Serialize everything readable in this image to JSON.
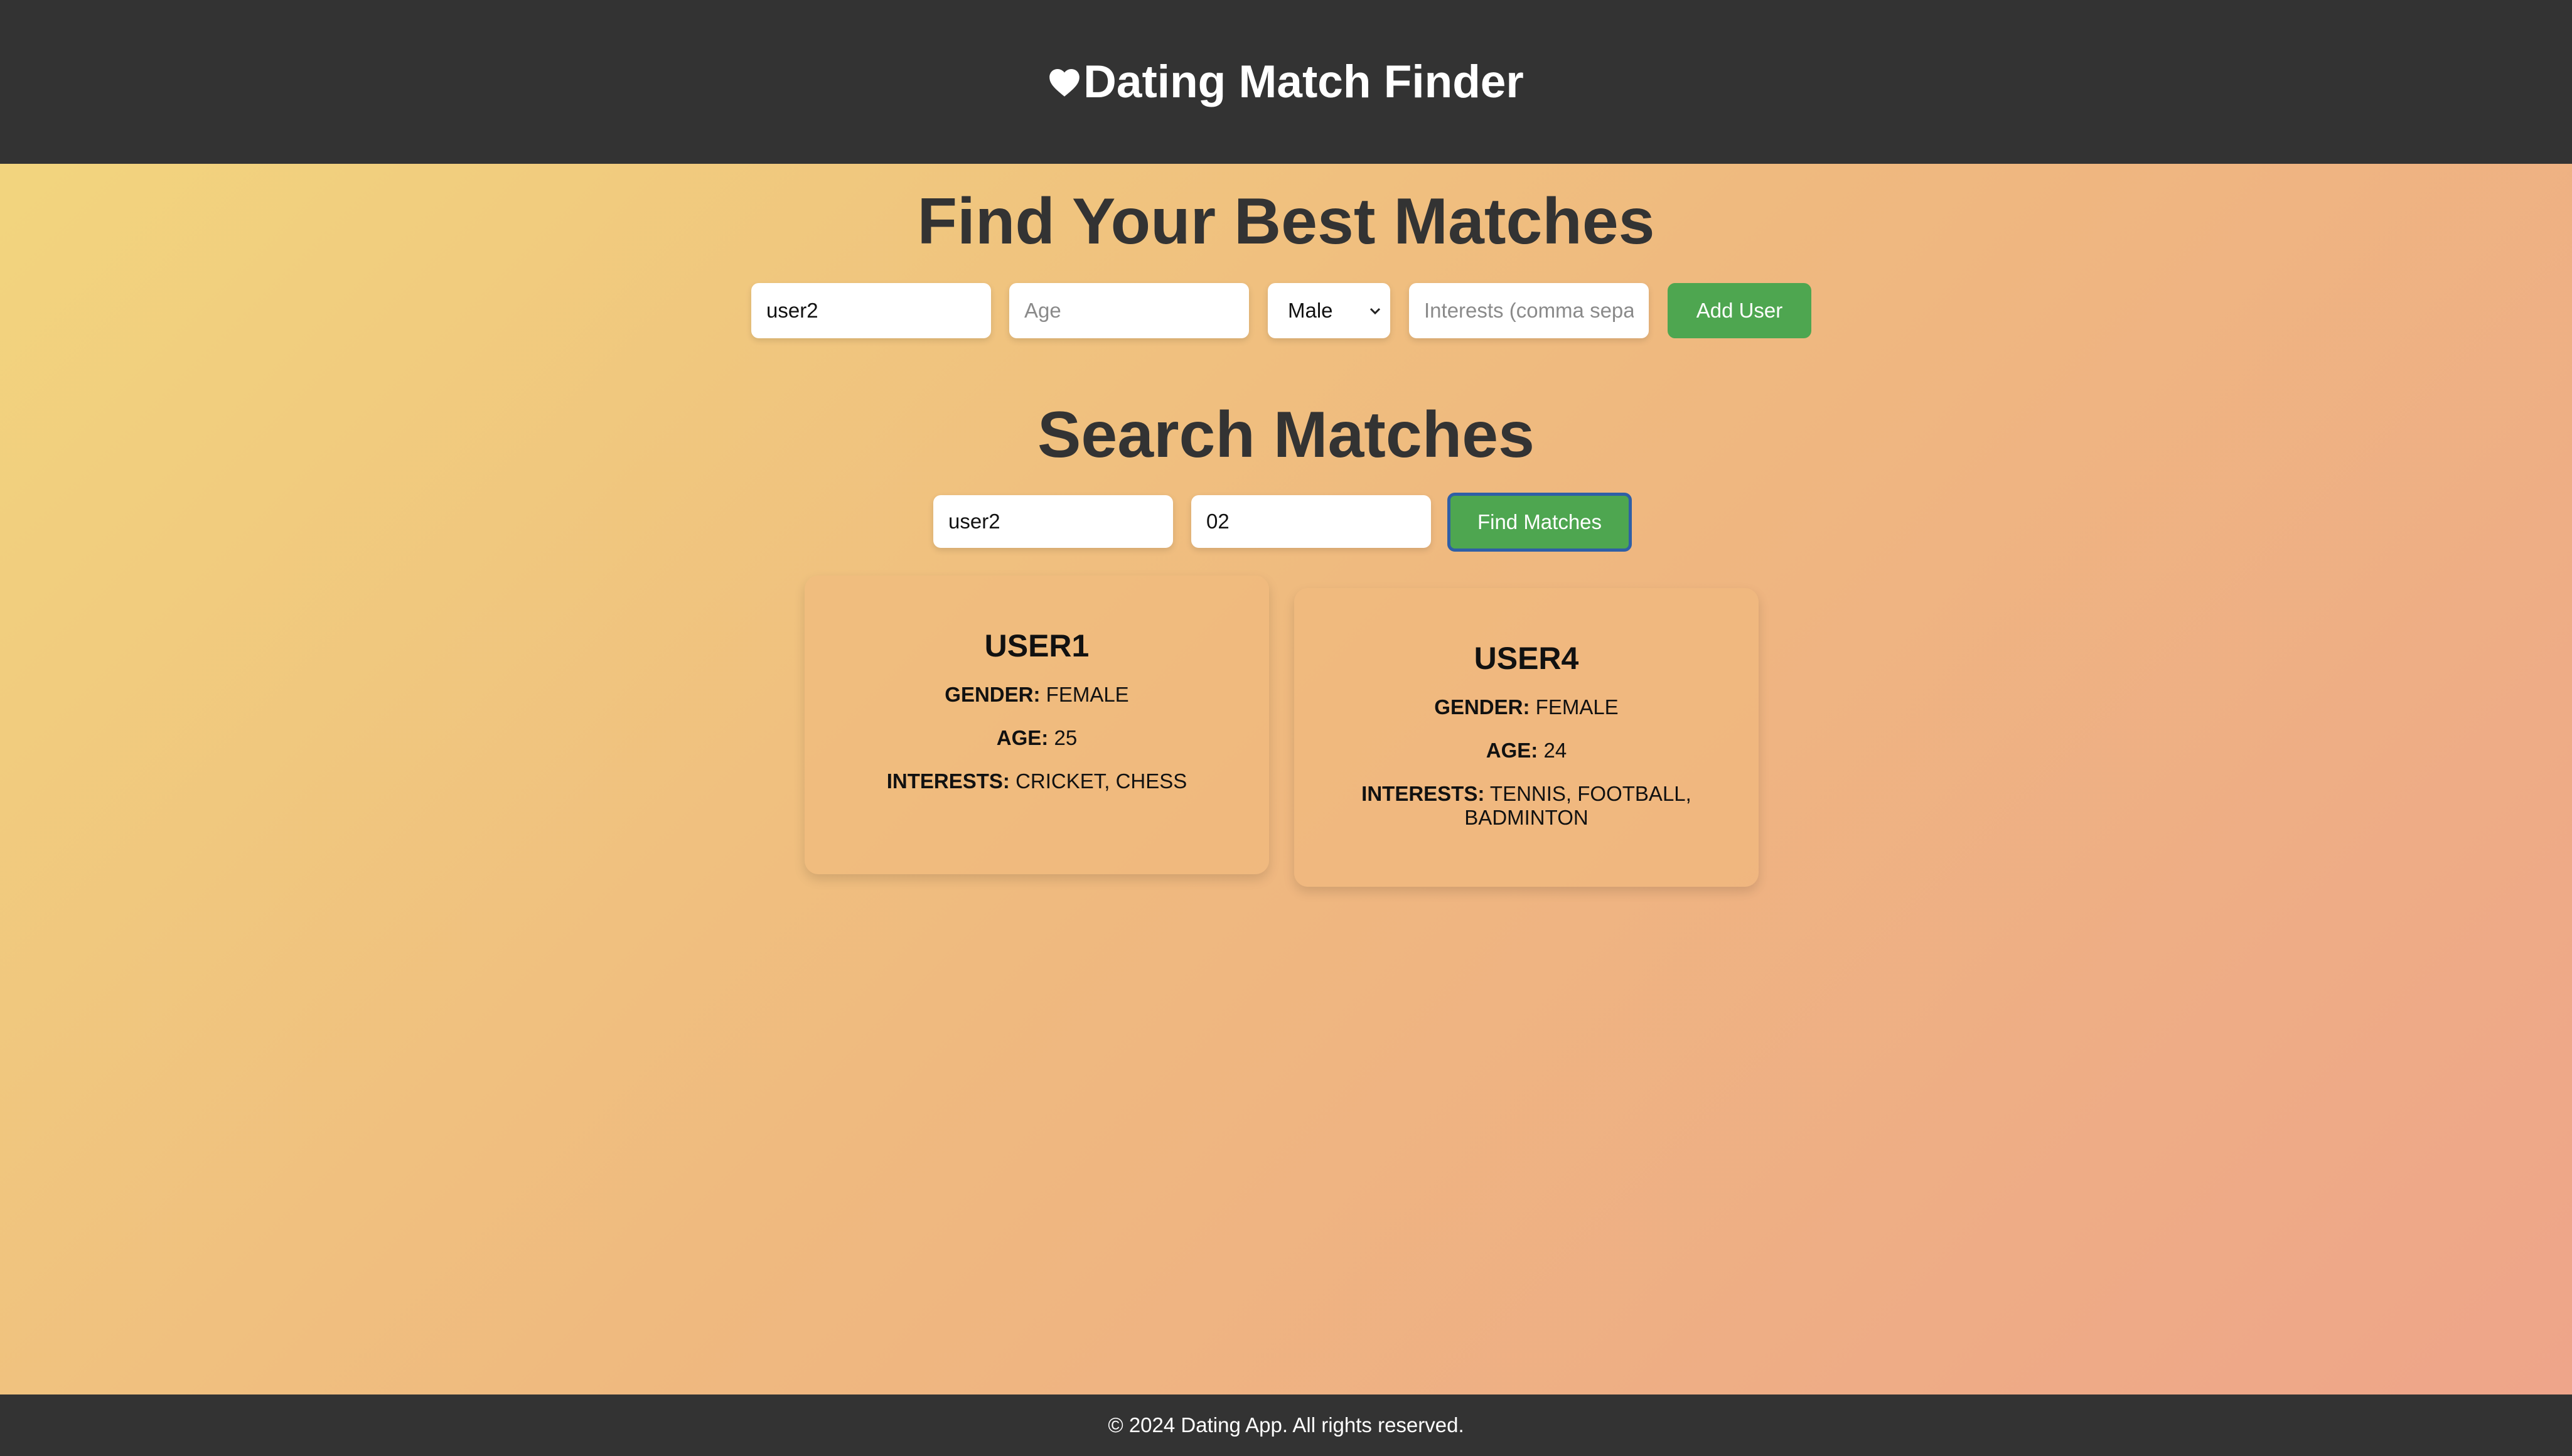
{
  "header": {
    "title": "Dating Match Finder",
    "icon": "heart-icon"
  },
  "add_user": {
    "heading": "Find Your Best Matches",
    "username_value": "user2",
    "age_placeholder": "Age",
    "gender_selected": "Male",
    "interests_placeholder": "Interests (comma separated)",
    "submit_label": "Add User"
  },
  "search": {
    "heading": "Search Matches",
    "username_value": "user2",
    "count_value": "02",
    "submit_label": "Find Matches"
  },
  "matches": [
    {
      "name": "USER1",
      "gender_label": "GENDER:",
      "gender": "FEMALE",
      "age_label": "AGE:",
      "age": "25",
      "interests_label": "INTERESTS:",
      "interests": "CRICKET, CHESS"
    },
    {
      "name": "USER4",
      "gender_label": "GENDER:",
      "gender": "FEMALE",
      "age_label": "AGE:",
      "age": "24",
      "interests_label": "INTERESTS:",
      "interests": "TENNIS, FOOTBALL, BADMINTON"
    }
  ],
  "footer": {
    "text": "© 2024 Dating App. All rights reserved."
  },
  "colors": {
    "header_bg": "#333333",
    "button_green": "#4ea650",
    "focus_ring": "#2f5fa6"
  }
}
